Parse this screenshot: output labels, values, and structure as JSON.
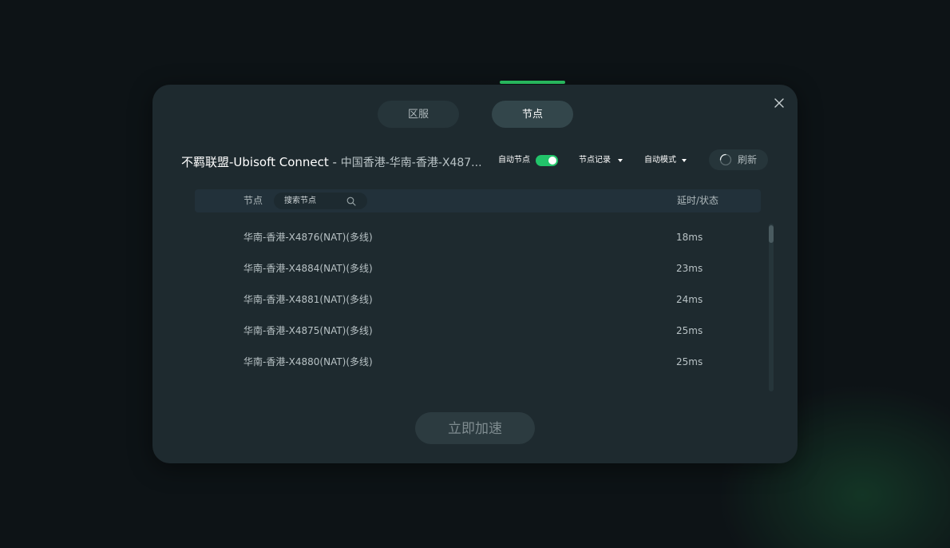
{
  "tabs": {
    "region": "区服",
    "node": "节点"
  },
  "header": {
    "game_name": "不羁联盟-Ubisoft Connect",
    "separator": " - ",
    "current_node": "中国香港-华南-香港-X487..."
  },
  "controls": {
    "auto_node_label": "自动节点",
    "auto_node_enabled": true,
    "node_history_label": "节点记录",
    "auto_mode_label": "自动模式",
    "refresh_label": "刷新"
  },
  "table": {
    "col_node": "节点",
    "search_placeholder": "搜索节点",
    "col_latency": "延时/状态",
    "rows": [
      {
        "name": "华南-香港-X4876(NAT)(多线)",
        "latency": "18ms"
      },
      {
        "name": "华南-香港-X4884(NAT)(多线)",
        "latency": "23ms"
      },
      {
        "name": "华南-香港-X4881(NAT)(多线)",
        "latency": "24ms"
      },
      {
        "name": "华南-香港-X4875(NAT)(多线)",
        "latency": "25ms"
      },
      {
        "name": "华南-香港-X4880(NAT)(多线)",
        "latency": "25ms"
      }
    ]
  },
  "accelerate_button": "立即加速",
  "colors": {
    "accent": "#2ecf6a",
    "modal_bg": "#1e2a2f",
    "toggle_on": "#22c46a"
  },
  "icons": {
    "close": "close-icon",
    "search": "search-icon",
    "dropdown": "caret-down-icon",
    "refresh": "loading-spinner-icon"
  }
}
